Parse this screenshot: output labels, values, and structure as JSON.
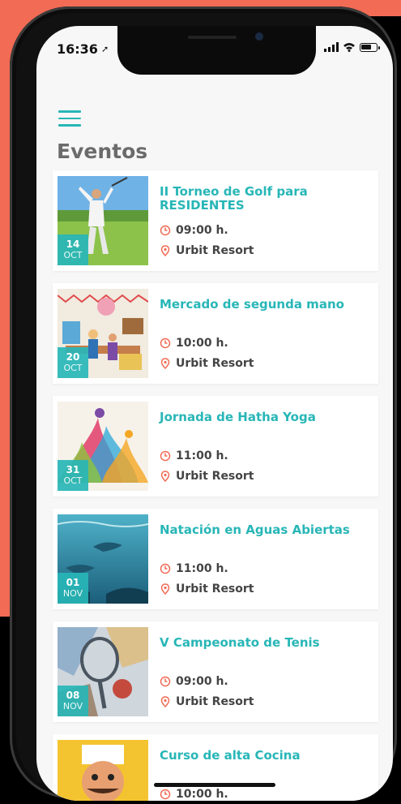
{
  "status": {
    "time": "16:36"
  },
  "header": {
    "title": "Eventos"
  },
  "colors": {
    "accent": "#28b6b7",
    "background_coral": "#f26b55"
  },
  "events": [
    {
      "day": "14",
      "month": "OCT",
      "title": "II Torneo de Golf para RESIDENTES",
      "time": "09:00 h.",
      "location": "Urbit Resort"
    },
    {
      "day": "20",
      "month": "OCT",
      "title": "Mercado de segunda mano",
      "time": "10:00 h.",
      "location": "Urbit Resort"
    },
    {
      "day": "31",
      "month": "OCT",
      "title": "Jornada de Hatha Yoga",
      "time": "11:00 h.",
      "location": "Urbit Resort"
    },
    {
      "day": "01",
      "month": "NOV",
      "title": "Natación en Aguas Abiertas",
      "time": "11:00 h.",
      "location": "Urbit Resort"
    },
    {
      "day": "08",
      "month": "NOV",
      "title": "V Campeonato de Tenis",
      "time": "09:00 h.",
      "location": "Urbit Resort"
    },
    {
      "title": "Curso de alta Cocina",
      "time": "10:00 h."
    }
  ]
}
